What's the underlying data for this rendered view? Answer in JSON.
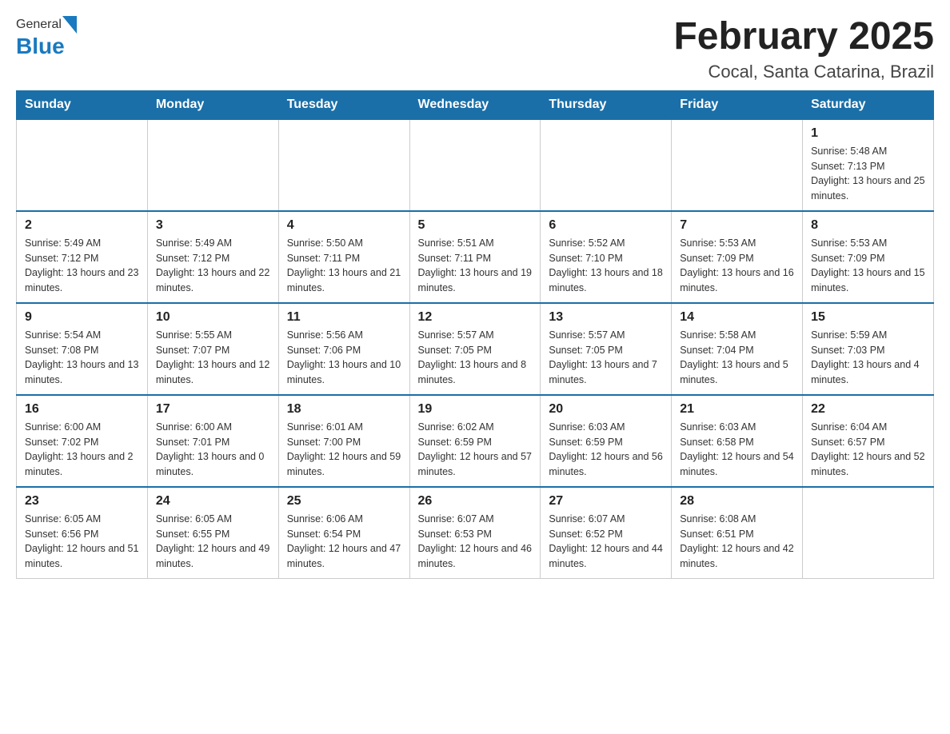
{
  "header": {
    "logo_general": "General",
    "logo_blue": "Blue",
    "title": "February 2025",
    "subtitle": "Cocal, Santa Catarina, Brazil"
  },
  "days_of_week": [
    "Sunday",
    "Monday",
    "Tuesday",
    "Wednesday",
    "Thursday",
    "Friday",
    "Saturday"
  ],
  "weeks": [
    [
      {
        "day": "",
        "info": ""
      },
      {
        "day": "",
        "info": ""
      },
      {
        "day": "",
        "info": ""
      },
      {
        "day": "",
        "info": ""
      },
      {
        "day": "",
        "info": ""
      },
      {
        "day": "",
        "info": ""
      },
      {
        "day": "1",
        "info": "Sunrise: 5:48 AM\nSunset: 7:13 PM\nDaylight: 13 hours and 25 minutes."
      }
    ],
    [
      {
        "day": "2",
        "info": "Sunrise: 5:49 AM\nSunset: 7:12 PM\nDaylight: 13 hours and 23 minutes."
      },
      {
        "day": "3",
        "info": "Sunrise: 5:49 AM\nSunset: 7:12 PM\nDaylight: 13 hours and 22 minutes."
      },
      {
        "day": "4",
        "info": "Sunrise: 5:50 AM\nSunset: 7:11 PM\nDaylight: 13 hours and 21 minutes."
      },
      {
        "day": "5",
        "info": "Sunrise: 5:51 AM\nSunset: 7:11 PM\nDaylight: 13 hours and 19 minutes."
      },
      {
        "day": "6",
        "info": "Sunrise: 5:52 AM\nSunset: 7:10 PM\nDaylight: 13 hours and 18 minutes."
      },
      {
        "day": "7",
        "info": "Sunrise: 5:53 AM\nSunset: 7:09 PM\nDaylight: 13 hours and 16 minutes."
      },
      {
        "day": "8",
        "info": "Sunrise: 5:53 AM\nSunset: 7:09 PM\nDaylight: 13 hours and 15 minutes."
      }
    ],
    [
      {
        "day": "9",
        "info": "Sunrise: 5:54 AM\nSunset: 7:08 PM\nDaylight: 13 hours and 13 minutes."
      },
      {
        "day": "10",
        "info": "Sunrise: 5:55 AM\nSunset: 7:07 PM\nDaylight: 13 hours and 12 minutes."
      },
      {
        "day": "11",
        "info": "Sunrise: 5:56 AM\nSunset: 7:06 PM\nDaylight: 13 hours and 10 minutes."
      },
      {
        "day": "12",
        "info": "Sunrise: 5:57 AM\nSunset: 7:05 PM\nDaylight: 13 hours and 8 minutes."
      },
      {
        "day": "13",
        "info": "Sunrise: 5:57 AM\nSunset: 7:05 PM\nDaylight: 13 hours and 7 minutes."
      },
      {
        "day": "14",
        "info": "Sunrise: 5:58 AM\nSunset: 7:04 PM\nDaylight: 13 hours and 5 minutes."
      },
      {
        "day": "15",
        "info": "Sunrise: 5:59 AM\nSunset: 7:03 PM\nDaylight: 13 hours and 4 minutes."
      }
    ],
    [
      {
        "day": "16",
        "info": "Sunrise: 6:00 AM\nSunset: 7:02 PM\nDaylight: 13 hours and 2 minutes."
      },
      {
        "day": "17",
        "info": "Sunrise: 6:00 AM\nSunset: 7:01 PM\nDaylight: 13 hours and 0 minutes."
      },
      {
        "day": "18",
        "info": "Sunrise: 6:01 AM\nSunset: 7:00 PM\nDaylight: 12 hours and 59 minutes."
      },
      {
        "day": "19",
        "info": "Sunrise: 6:02 AM\nSunset: 6:59 PM\nDaylight: 12 hours and 57 minutes."
      },
      {
        "day": "20",
        "info": "Sunrise: 6:03 AM\nSunset: 6:59 PM\nDaylight: 12 hours and 56 minutes."
      },
      {
        "day": "21",
        "info": "Sunrise: 6:03 AM\nSunset: 6:58 PM\nDaylight: 12 hours and 54 minutes."
      },
      {
        "day": "22",
        "info": "Sunrise: 6:04 AM\nSunset: 6:57 PM\nDaylight: 12 hours and 52 minutes."
      }
    ],
    [
      {
        "day": "23",
        "info": "Sunrise: 6:05 AM\nSunset: 6:56 PM\nDaylight: 12 hours and 51 minutes."
      },
      {
        "day": "24",
        "info": "Sunrise: 6:05 AM\nSunset: 6:55 PM\nDaylight: 12 hours and 49 minutes."
      },
      {
        "day": "25",
        "info": "Sunrise: 6:06 AM\nSunset: 6:54 PM\nDaylight: 12 hours and 47 minutes."
      },
      {
        "day": "26",
        "info": "Sunrise: 6:07 AM\nSunset: 6:53 PM\nDaylight: 12 hours and 46 minutes."
      },
      {
        "day": "27",
        "info": "Sunrise: 6:07 AM\nSunset: 6:52 PM\nDaylight: 12 hours and 44 minutes."
      },
      {
        "day": "28",
        "info": "Sunrise: 6:08 AM\nSunset: 6:51 PM\nDaylight: 12 hours and 42 minutes."
      },
      {
        "day": "",
        "info": ""
      }
    ]
  ]
}
